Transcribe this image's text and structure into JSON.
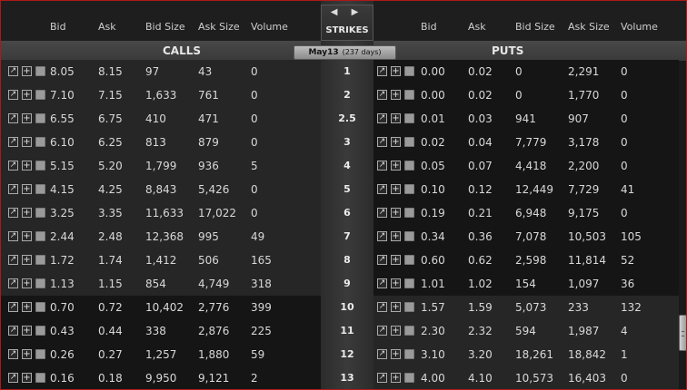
{
  "headers": {
    "calls_cols": [
      "Bid",
      "Ask",
      "Bid Size",
      "Ask Size",
      "Volume"
    ],
    "puts_cols": [
      "Bid",
      "Ask",
      "Bid Size",
      "Ask Size",
      "Volume"
    ],
    "calls_title": "CALLS",
    "puts_title": "PUTS",
    "strikes_label": "STRIKES",
    "strike_nav": "◀ ▶",
    "expiry": "May13",
    "expiry_days": "(237 days)"
  },
  "rows": [
    {
      "strike": "1",
      "itm": true,
      "call": [
        "8.05",
        "8.15",
        "97",
        "43",
        "0"
      ],
      "put": [
        "0.00",
        "0.02",
        "0",
        "2,291",
        "0"
      ]
    },
    {
      "strike": "2",
      "itm": true,
      "call": [
        "7.10",
        "7.15",
        "1,633",
        "761",
        "0"
      ],
      "put": [
        "0.00",
        "0.02",
        "0",
        "1,770",
        "0"
      ]
    },
    {
      "strike": "2.5",
      "itm": true,
      "call": [
        "6.55",
        "6.75",
        "410",
        "471",
        "0"
      ],
      "put": [
        "0.01",
        "0.03",
        "941",
        "907",
        "0"
      ]
    },
    {
      "strike": "3",
      "itm": true,
      "call": [
        "6.10",
        "6.25",
        "813",
        "879",
        "0"
      ],
      "put": [
        "0.02",
        "0.04",
        "7,779",
        "3,178",
        "0"
      ]
    },
    {
      "strike": "4",
      "itm": true,
      "call": [
        "5.15",
        "5.20",
        "1,799",
        "936",
        "5"
      ],
      "put": [
        "0.05",
        "0.07",
        "4,418",
        "2,200",
        "0"
      ]
    },
    {
      "strike": "5",
      "itm": true,
      "call": [
        "4.15",
        "4.25",
        "8,843",
        "5,426",
        "0"
      ],
      "put": [
        "0.10",
        "0.12",
        "12,449",
        "7,729",
        "41"
      ]
    },
    {
      "strike": "6",
      "itm": true,
      "call": [
        "3.25",
        "3.35",
        "11,633",
        "17,022",
        "0"
      ],
      "put": [
        "0.19",
        "0.21",
        "6,948",
        "9,175",
        "0"
      ]
    },
    {
      "strike": "7",
      "itm": true,
      "call": [
        "2.44",
        "2.48",
        "12,368",
        "995",
        "49"
      ],
      "put": [
        "0.34",
        "0.36",
        "7,078",
        "10,503",
        "105"
      ]
    },
    {
      "strike": "8",
      "itm": true,
      "call": [
        "1.72",
        "1.74",
        "1,412",
        "506",
        "165"
      ],
      "put": [
        "0.60",
        "0.62",
        "2,598",
        "11,814",
        "52"
      ]
    },
    {
      "strike": "9",
      "itm": true,
      "call": [
        "1.13",
        "1.15",
        "854",
        "4,749",
        "318"
      ],
      "put": [
        "1.01",
        "1.02",
        "154",
        "1,097",
        "36"
      ]
    },
    {
      "strike": "10",
      "itm": false,
      "call": [
        "0.70",
        "0.72",
        "10,402",
        "2,776",
        "399"
      ],
      "put": [
        "1.57",
        "1.59",
        "5,073",
        "233",
        "132"
      ]
    },
    {
      "strike": "11",
      "itm": false,
      "call": [
        "0.43",
        "0.44",
        "338",
        "2,876",
        "225"
      ],
      "put": [
        "2.30",
        "2.32",
        "594",
        "1,987",
        "4"
      ]
    },
    {
      "strike": "12",
      "itm": false,
      "call": [
        "0.26",
        "0.27",
        "1,257",
        "1,880",
        "59"
      ],
      "put": [
        "3.10",
        "3.20",
        "18,261",
        "18,842",
        "1"
      ]
    },
    {
      "strike": "13",
      "itm": false,
      "call": [
        "0.16",
        "0.18",
        "9,950",
        "9,121",
        "2"
      ],
      "put": [
        "4.00",
        "4.10",
        "10,573",
        "16,403",
        "0"
      ]
    }
  ]
}
